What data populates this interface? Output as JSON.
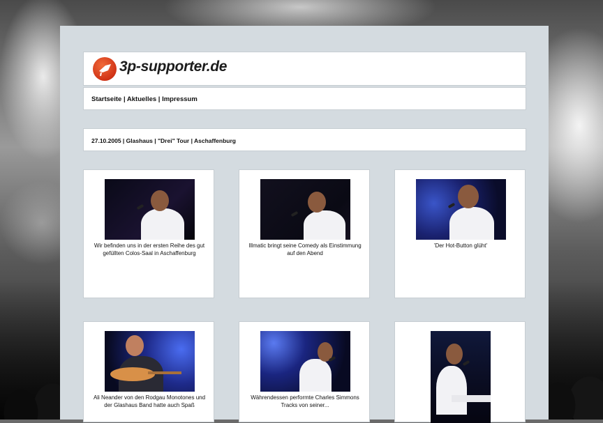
{
  "site": {
    "logo_text": "3p-supporter.de"
  },
  "nav": {
    "items": [
      "Startseite",
      "Aktuelles",
      "Impressum"
    ],
    "separator": " | "
  },
  "breadcrumb": {
    "text": "27.10.2005 | Glashaus | \"Drei\" Tour | Aschaffenburg"
  },
  "gallery": {
    "items": [
      {
        "caption": "Wir befinden uns in der ersten Reihe des gut gefüllten Colos-Saal in Aschaffenburg"
      },
      {
        "caption": "Illmatic bringt seine Comedy als Einstimmung auf den Abend"
      },
      {
        "caption": "'Der Hot-Button glüht'"
      },
      {
        "caption": "Ali Neander von den Rodgau Monotones und der Glashaus Band hatte auch Spaß"
      },
      {
        "caption": "Währendessen performte Charles Simmons Tracks von seiner..."
      },
      {
        "caption": ""
      }
    ]
  },
  "colors": {
    "panel": "#d4dbe0",
    "box": "#ffffff",
    "logo_red": "#d13316"
  },
  "icons": {
    "logo": "3p-megaphone-logo-icon"
  }
}
